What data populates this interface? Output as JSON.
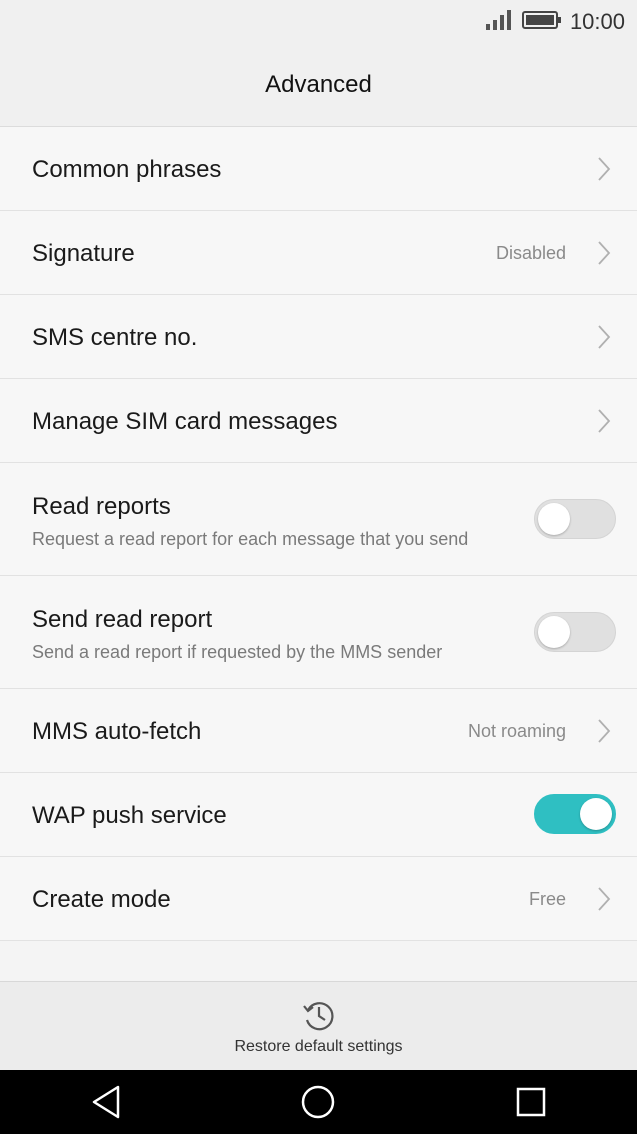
{
  "status": {
    "time": "10:00",
    "signal_icon": "signal-icon",
    "battery_icon": "battery-icon"
  },
  "header": {
    "title": "Advanced"
  },
  "settings": [
    {
      "title": "Common phrases",
      "value": "",
      "control": "chevron"
    },
    {
      "title": "Signature",
      "value": "Disabled",
      "control": "chevron"
    },
    {
      "title": "SMS centre no.",
      "value": "",
      "control": "chevron"
    },
    {
      "title": "Manage SIM card messages",
      "value": "",
      "control": "chevron"
    },
    {
      "title": "Read reports",
      "subtitle": "Request a read report for each message that you send",
      "control": "toggle",
      "enabled": false
    },
    {
      "title": "Send read report",
      "subtitle": "Send a read report if requested by the MMS sender",
      "control": "toggle",
      "enabled": false
    },
    {
      "title": "MMS auto-fetch",
      "value": "Not roaming",
      "control": "chevron"
    },
    {
      "title": "WAP push service",
      "control": "toggle",
      "enabled": true
    },
    {
      "title": "Create mode",
      "value": "Free",
      "control": "chevron"
    }
  ],
  "footer": {
    "restore_label": "Restore default settings",
    "restore_icon": "restore-history-icon"
  },
  "navigation": {
    "back_icon": "back-triangle-icon",
    "home_icon": "home-circle-icon",
    "recents_icon": "recents-square-icon"
  },
  "colors": {
    "accent": "#2fbfc2",
    "background": "#f4f4f4",
    "navbar": "#000000"
  }
}
